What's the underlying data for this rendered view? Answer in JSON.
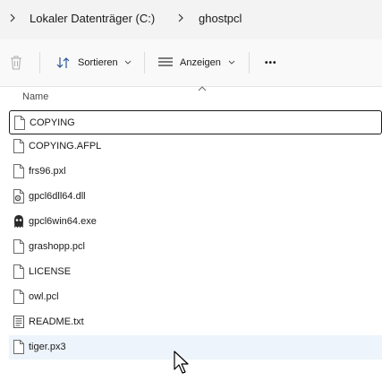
{
  "breadcrumb": {
    "items": [
      "Lokaler Datenträger (C:)",
      "ghostpcl"
    ]
  },
  "commandbar": {
    "sort_label": "Sortieren",
    "view_label": "Anzeigen",
    "more_label": "•••"
  },
  "columns": {
    "name": "Name"
  },
  "files": [
    {
      "name": "COPYING",
      "icon": "document-icon"
    },
    {
      "name": "COPYING.AFPL",
      "icon": "document-icon"
    },
    {
      "name": "frs96.pxl",
      "icon": "document-icon"
    },
    {
      "name": "gpcl6dll64.dll",
      "icon": "dll-settings-icon"
    },
    {
      "name": "gpcl6win64.exe",
      "icon": "ghostscript-app-icon"
    },
    {
      "name": "grashopp.pcl",
      "icon": "document-icon"
    },
    {
      "name": "LICENSE",
      "icon": "document-icon"
    },
    {
      "name": "owl.pcl",
      "icon": "document-icon"
    },
    {
      "name": "README.txt",
      "icon": "text-file-icon"
    },
    {
      "name": "tiger.px3",
      "icon": "document-icon"
    }
  ],
  "state": {
    "focused_row": 0,
    "hovered_row": 9
  }
}
